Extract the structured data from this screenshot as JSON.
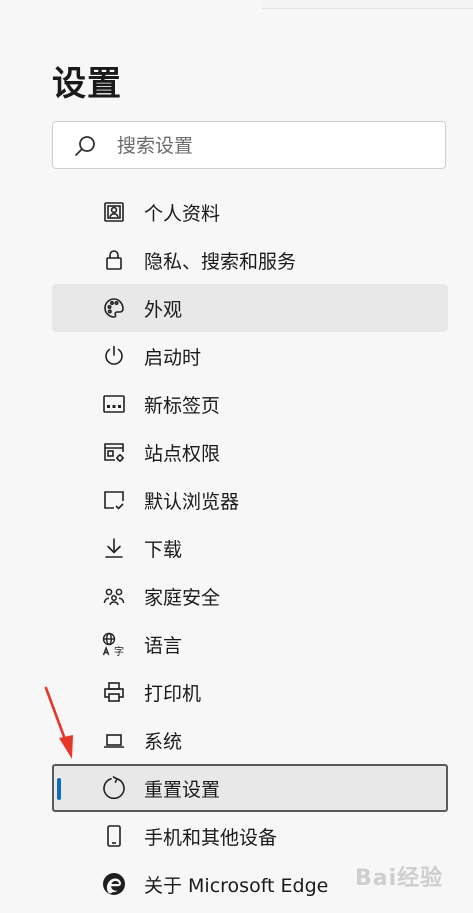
{
  "page": {
    "title": "设置",
    "search_placeholder": "搜索设置",
    "watermark": "Bai经验"
  },
  "nav": {
    "items": [
      {
        "label": "个人资料",
        "icon": "profile-icon"
      },
      {
        "label": "隐私、搜索和服务",
        "icon": "lock-icon"
      },
      {
        "label": "外观",
        "icon": "palette-icon",
        "state": "hover"
      },
      {
        "label": "启动时",
        "icon": "power-icon"
      },
      {
        "label": "新标签页",
        "icon": "new-tab-icon"
      },
      {
        "label": "站点权限",
        "icon": "site-permissions-icon"
      },
      {
        "label": "默认浏览器",
        "icon": "default-browser-icon"
      },
      {
        "label": "下载",
        "icon": "download-icon"
      },
      {
        "label": "家庭安全",
        "icon": "family-icon"
      },
      {
        "label": "语言",
        "icon": "language-icon"
      },
      {
        "label": "打印机",
        "icon": "printer-icon"
      },
      {
        "label": "系统",
        "icon": "laptop-icon"
      },
      {
        "label": "重置设置",
        "icon": "reset-icon",
        "state": "selected"
      },
      {
        "label": "手机和其他设备",
        "icon": "phone-icon"
      },
      {
        "label": "关于 Microsoft Edge",
        "icon": "edge-logo-icon"
      }
    ]
  },
  "colors": {
    "accent": "#0f6cbd",
    "annotation_arrow": "#e8352b",
    "background": "#f7f7f7",
    "hover_background": "#e8e8e8"
  }
}
